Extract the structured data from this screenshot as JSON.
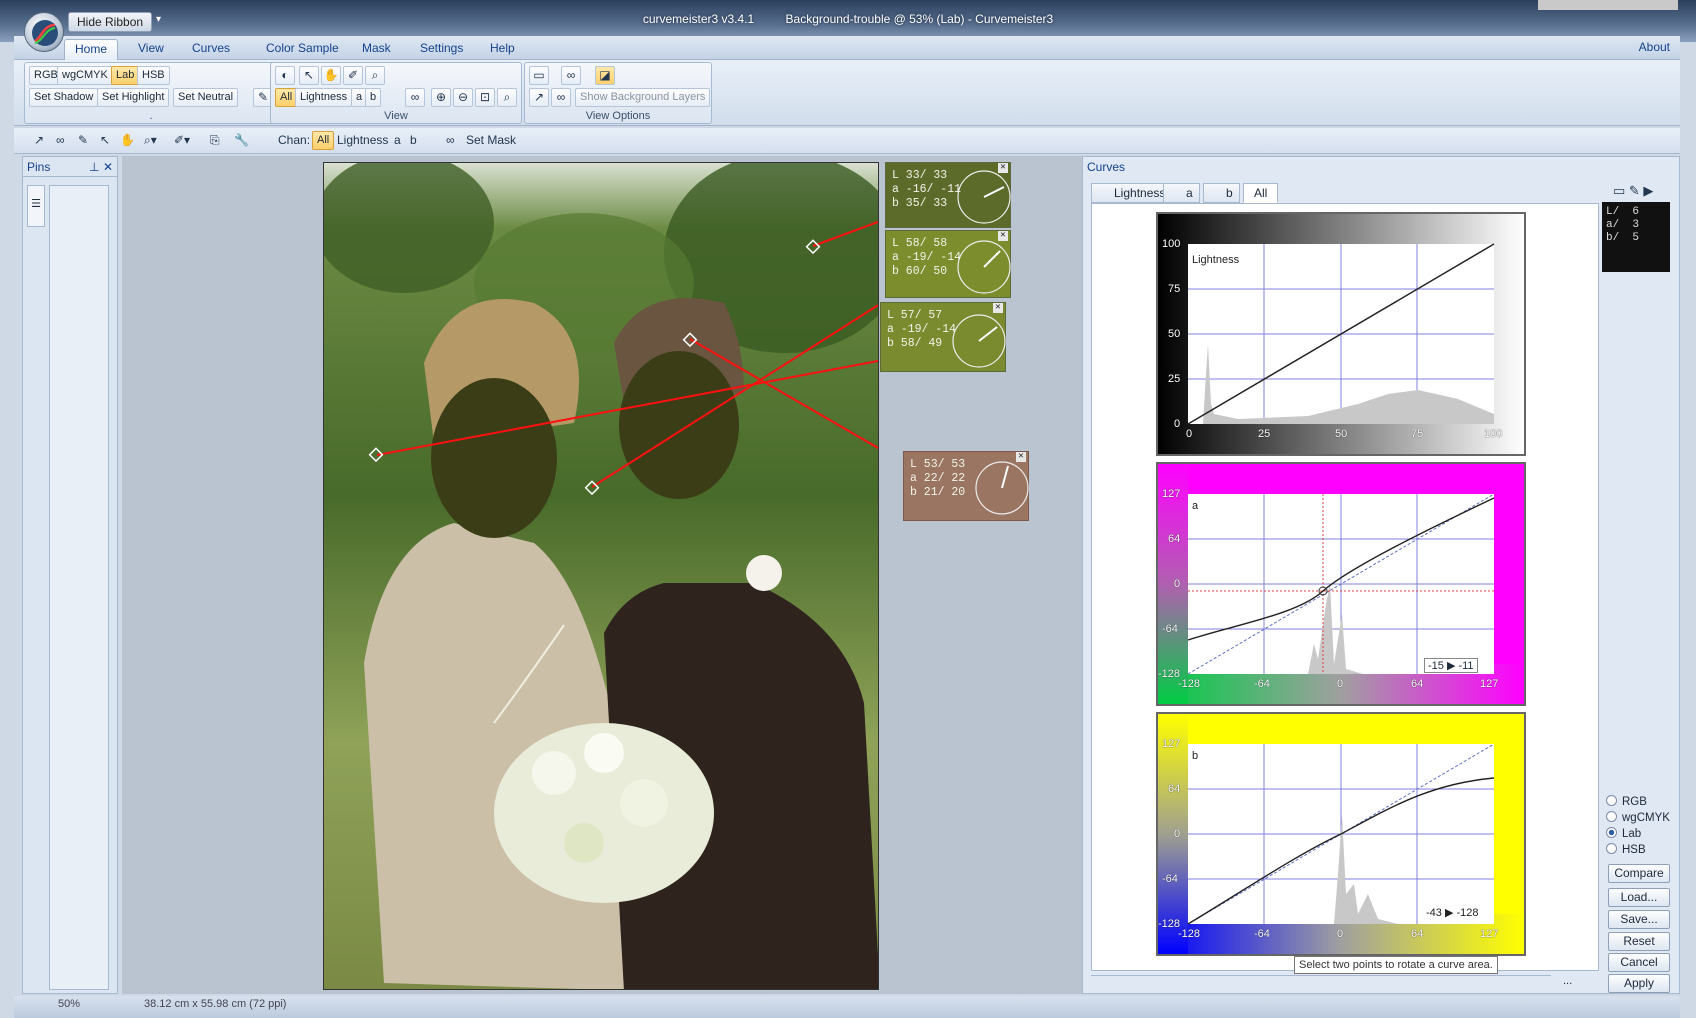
{
  "window": {
    "app_title": "curvemeister3 v3.4.1",
    "doc_title": "Background-trouble @ 53% (Lab) - Curvemeister3",
    "hide_ribbon": "Hide Ribbon"
  },
  "ribbon_tabs": [
    "Home",
    "View",
    "Curves",
    "Color Sample",
    "Mask",
    "Settings",
    "Help"
  ],
  "about": "About",
  "ribbon": {
    "modes": [
      "RGB",
      "wgCMYK",
      "Lab",
      "HSB"
    ],
    "set_buttons": [
      "Set Shadow",
      "Set Highlight",
      "Set Neutral"
    ],
    "channels": [
      "All",
      "Lightness",
      "a",
      "b"
    ],
    "view_label": "View",
    "view_options_label": "View Options",
    "show_bg_layers": "Show Background Layers",
    "group1_label": "."
  },
  "toolbar": {
    "chan_label": "Chan:",
    "channels": [
      "All",
      "Lightness",
      "a",
      "b"
    ],
    "set_mask": "Set Mask"
  },
  "pins": {
    "title": "Pins"
  },
  "samples": [
    {
      "L": "L  33/ 33",
      "a": "a  -16/ -11",
      "b": "b  35/ 33",
      "color": "#5c6b2a"
    },
    {
      "L": "L  58/ 58",
      "a": "a  -19/ -14",
      "b": "b  60/ 50",
      "color": "#7b8d2c"
    },
    {
      "L": "L  57/ 57",
      "a": "a  -19/ -14",
      "b": "b  58/ 49",
      "color": "#7a8a2e"
    },
    {
      "L": "L  53/ 53",
      "a": "a  22/ 22",
      "b": "b  21/ 20",
      "color": "#9a7562"
    }
  ],
  "curves": {
    "title": "Curves",
    "tabs": [
      "Lightness",
      "a",
      "b",
      "All"
    ],
    "lightness": {
      "name": "Lightness",
      "yticks": [
        "100",
        "75",
        "50",
        "25",
        "0"
      ],
      "xticks": [
        "0",
        "25",
        "50",
        "75",
        "100"
      ]
    },
    "a": {
      "name": "a",
      "yticks": [
        "127",
        "64",
        "0",
        "-64",
        "-128"
      ],
      "xticks": [
        "-128",
        "-64",
        "0",
        "64",
        "127"
      ],
      "readout": "-15 ▶ -11"
    },
    "b": {
      "name": "b",
      "yticks": [
        "127",
        "64",
        "0",
        "-64",
        "-128"
      ],
      "xticks": [
        "-128",
        "-64",
        "0",
        "64",
        "127"
      ],
      "readout": "-43 ▶ -128"
    },
    "color_modes": [
      "RGB",
      "wgCMYK",
      "Lab",
      "HSB"
    ],
    "selected_mode": "Lab",
    "buttons": [
      "Compare",
      "Load...",
      "Save...",
      "Reset",
      "Cancel",
      "Apply"
    ],
    "mini_readout": "L/  6\na/  3\nb/  5",
    "tooltip": "Select two points to rotate a curve area.",
    "ellipsis": "..."
  },
  "status": {
    "zoom": "50%",
    "size": "38.12 cm x 55.98 cm (72 ppi)"
  },
  "colors": {
    "accent": "#15428b",
    "curve_line": "#cc0000",
    "a_plus": "#ff00ff",
    "a_minus": "#00cc00",
    "b_plus": "#ffff00",
    "b_minus": "#0000ff"
  }
}
